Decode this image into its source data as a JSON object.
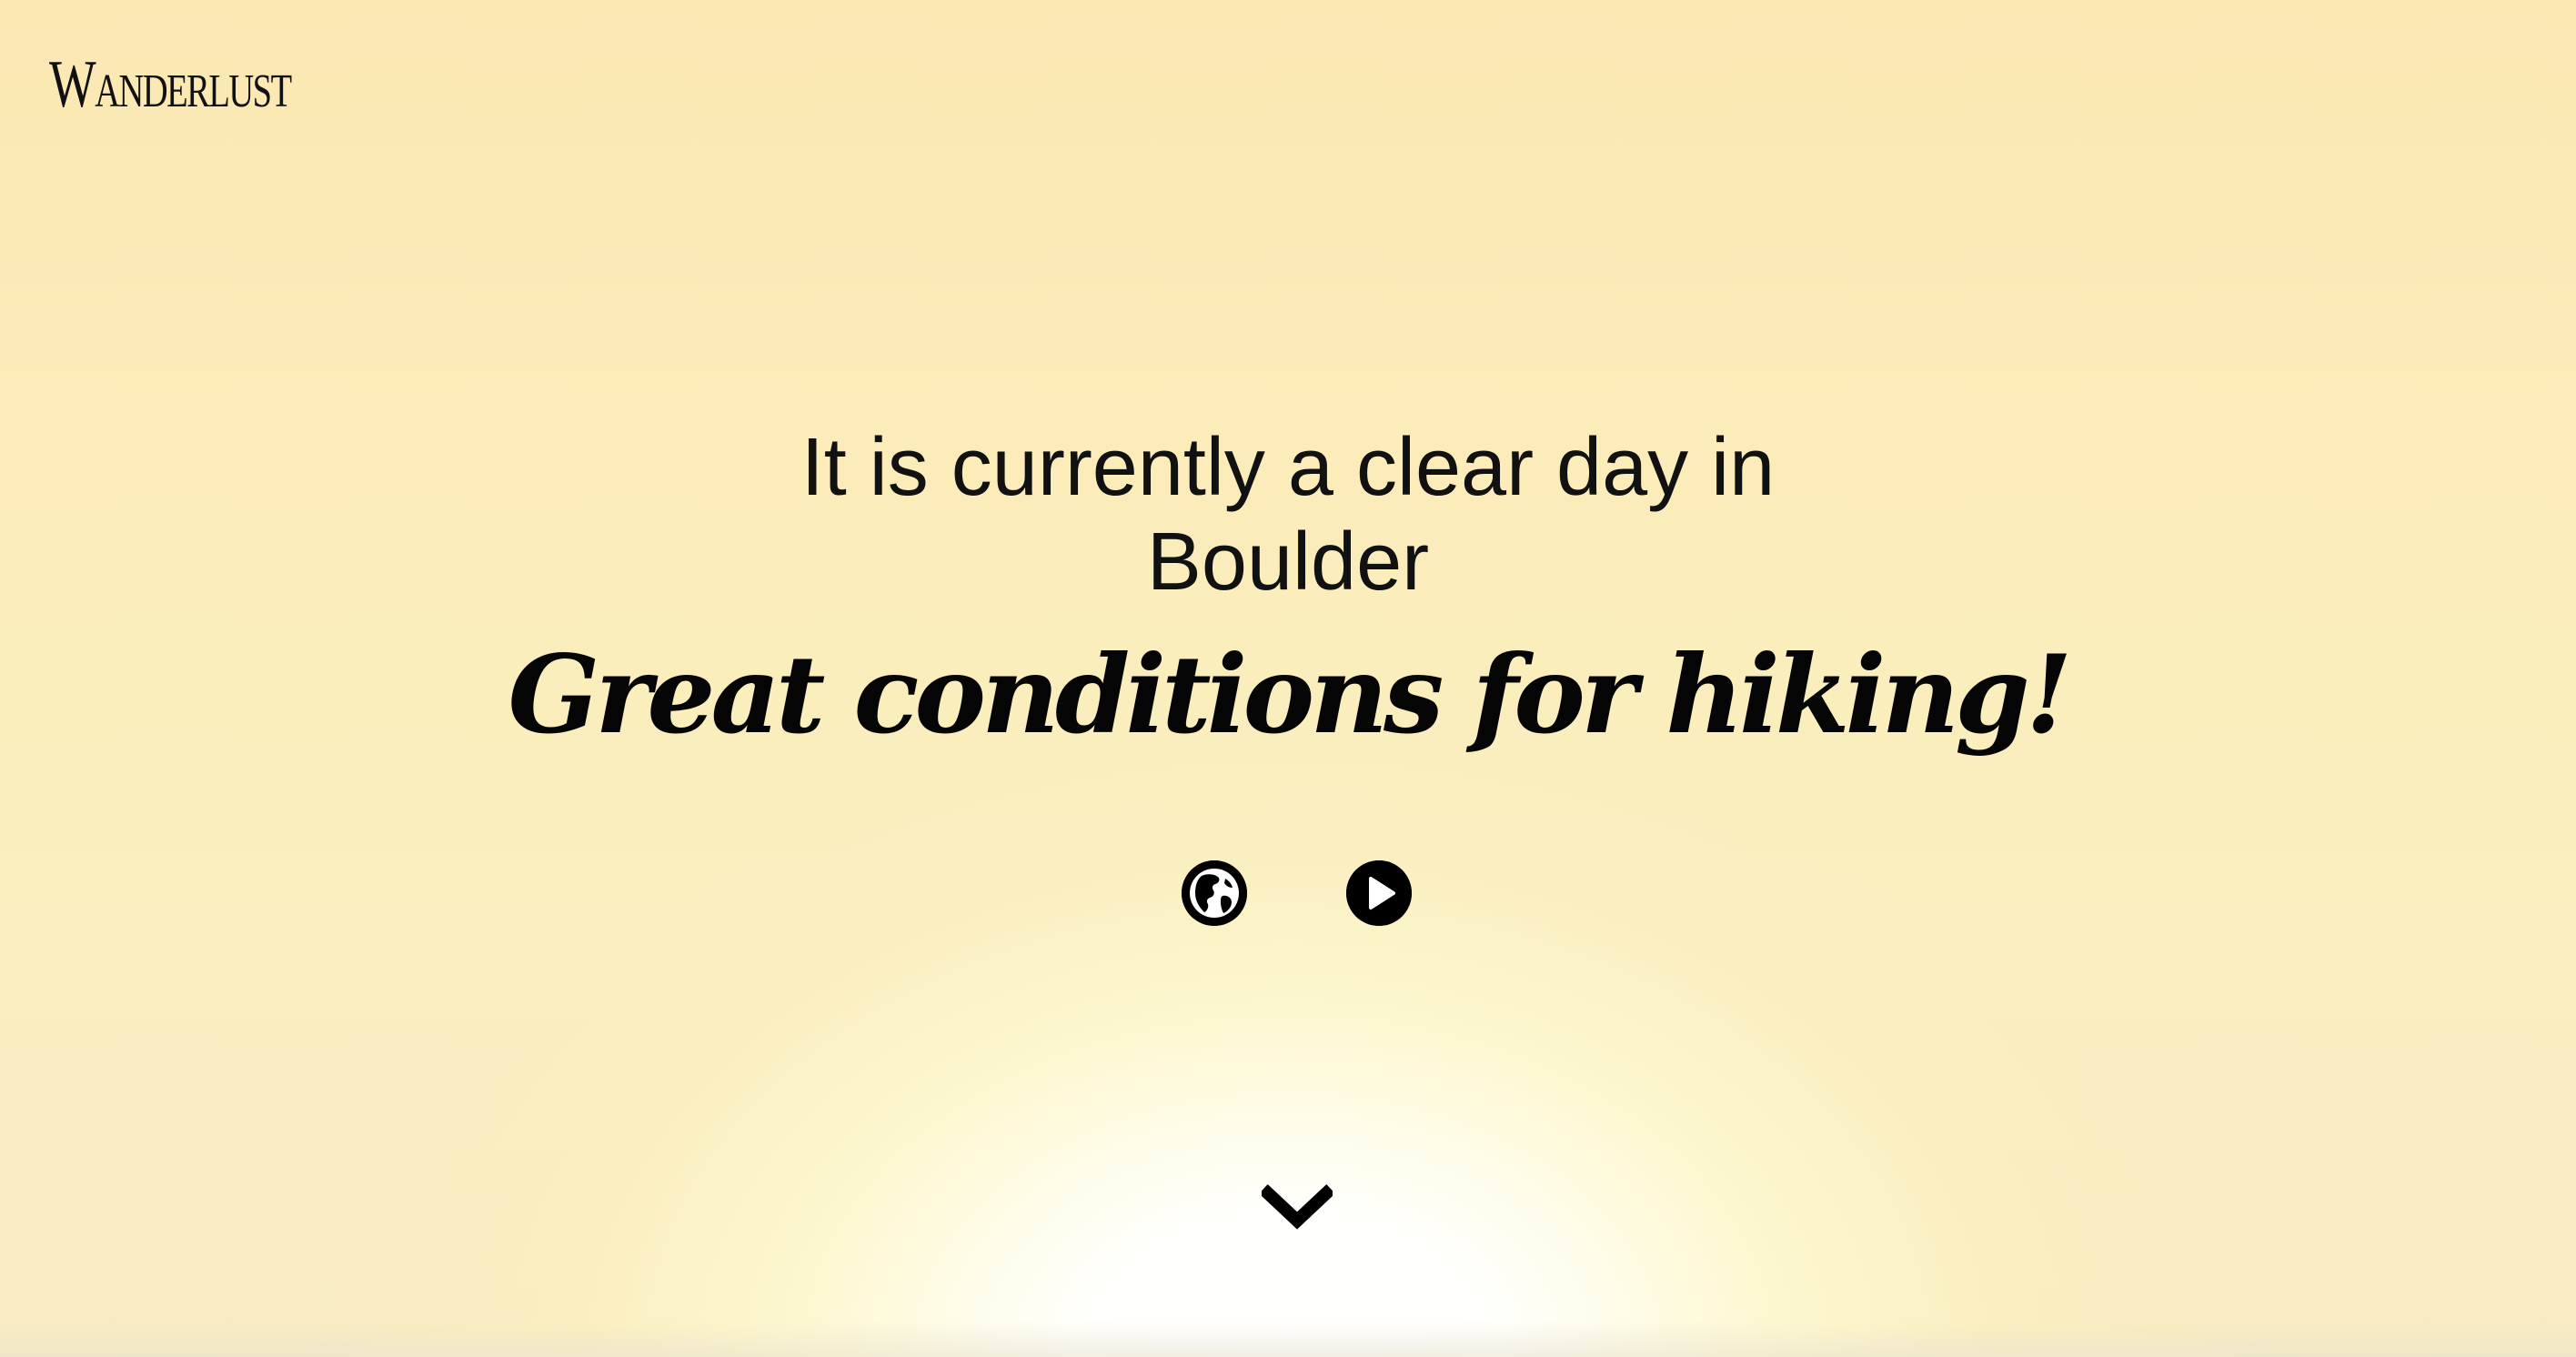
{
  "header": {
    "brand": "Wanderlust"
  },
  "hero": {
    "headline_line1": "It is currently a clear day in",
    "headline_line2": "Boulder",
    "tagline": "Great conditions for hiking!"
  },
  "actions": {
    "globe_icon": "globe-icon",
    "play_icon": "play-icon"
  },
  "scroll": {
    "icon": "chevron-down-icon"
  },
  "colors": {
    "text": "#000000",
    "background_top": "#fbe8b3",
    "background_glow": "#ffffff"
  }
}
